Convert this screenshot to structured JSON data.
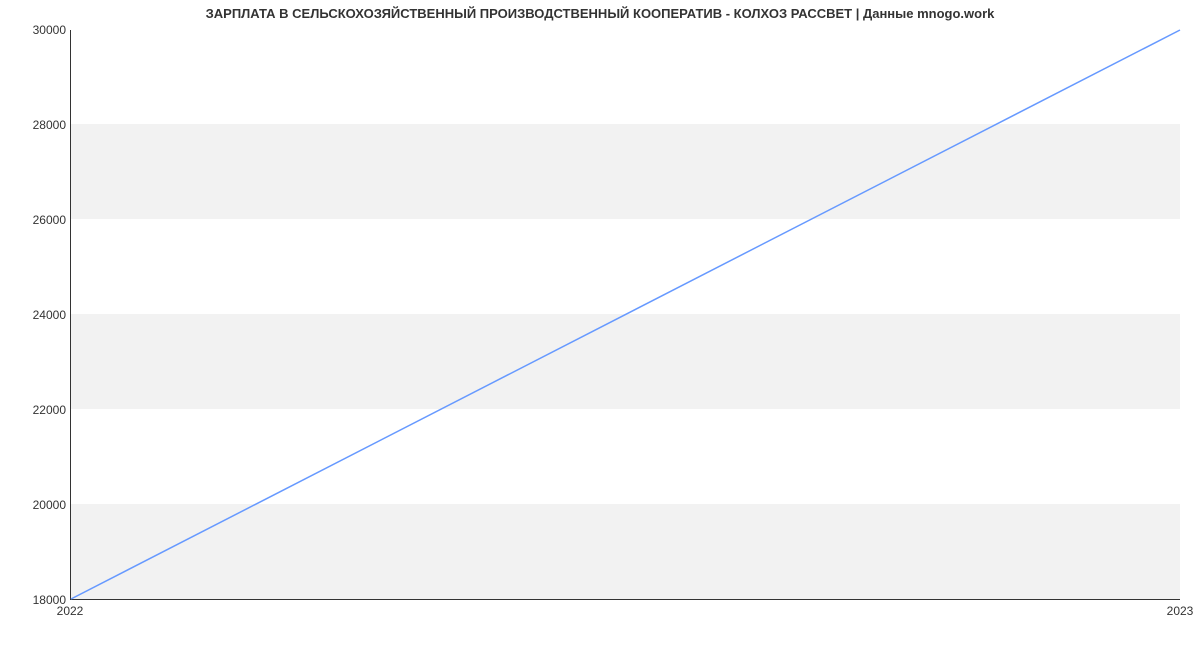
{
  "chart_data": {
    "type": "line",
    "title": "ЗАРПЛАТА В СЕЛЬСКОХОЗЯЙСТВЕННЫЙ ПРОИЗВОДСТВЕННЫЙ КООПЕРАТИВ - КОЛХОЗ РАССВЕТ | Данные mnogo.work",
    "x": [
      2022,
      2023
    ],
    "values": [
      18000,
      30000
    ],
    "xlabel": "",
    "ylabel": "",
    "xticks": [
      2022,
      2023
    ],
    "yticks": [
      18000,
      20000,
      22000,
      24000,
      26000,
      28000,
      30000
    ],
    "ylim": [
      18000,
      30000
    ],
    "xlim": [
      2022,
      2023
    ],
    "line_color": "#6699ff",
    "grid_band_color": "#f2f2f2"
  },
  "labels": {
    "x_2022": "2022",
    "x_2023": "2023",
    "y_18000": "18000",
    "y_20000": "20000",
    "y_22000": "22000",
    "y_24000": "24000",
    "y_26000": "26000",
    "y_28000": "28000",
    "y_30000": "30000"
  }
}
